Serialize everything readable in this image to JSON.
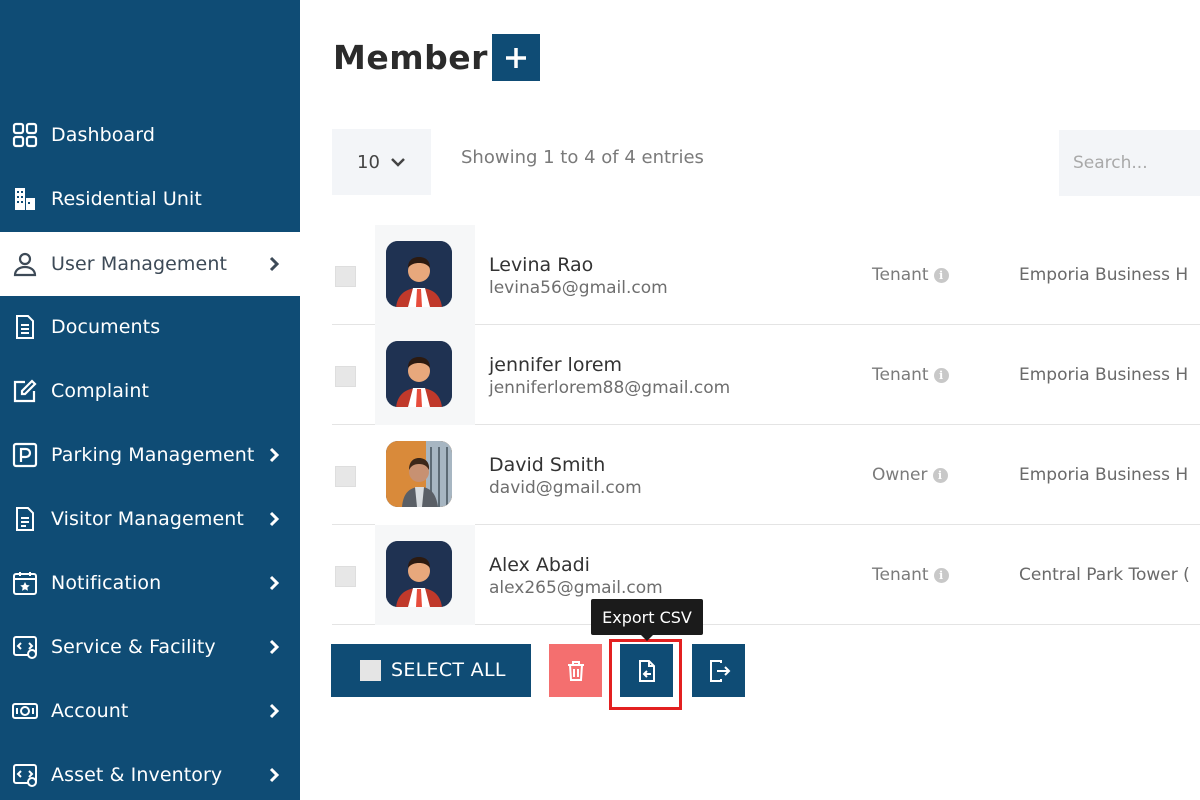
{
  "sidebar": {
    "items": [
      {
        "label": "Dashboard",
        "icon": "grid-icon",
        "chevron": false,
        "active": false
      },
      {
        "label": "Residential Unit",
        "icon": "building-icon",
        "chevron": false,
        "active": false
      },
      {
        "label": "User Management",
        "icon": "user-icon",
        "chevron": true,
        "active": true
      },
      {
        "label": "Documents",
        "icon": "document-icon",
        "chevron": false,
        "active": false
      },
      {
        "label": "Complaint",
        "icon": "edit-icon",
        "chevron": false,
        "active": false
      },
      {
        "label": "Parking Management",
        "icon": "parking-icon",
        "chevron": true,
        "active": false
      },
      {
        "label": "Visitor Management",
        "icon": "file-icon",
        "chevron": true,
        "active": false
      },
      {
        "label": "Notification",
        "icon": "calendar-star-icon",
        "chevron": true,
        "active": false
      },
      {
        "label": "Service & Facility",
        "icon": "service-icon",
        "chevron": true,
        "active": false
      },
      {
        "label": "Account",
        "icon": "money-icon",
        "chevron": true,
        "active": false
      },
      {
        "label": "Asset & Inventory",
        "icon": "asset-icon",
        "chevron": true,
        "active": false
      }
    ]
  },
  "main": {
    "title": "Member",
    "page_length": "10",
    "entries_info": "Showing 1 to 4 of 4 entries",
    "search_placeholder": "Search...",
    "rows": [
      {
        "name": "Levina Rao",
        "email": "levina56@gmail.com",
        "role": "Tenant",
        "unit": "Emporia Business H",
        "avatar": "male-avatar-icon"
      },
      {
        "name": "jennifer lorem",
        "email": "jenniferlorem88@gmail.com",
        "role": "Tenant",
        "unit": "Emporia Business H",
        "avatar": "male-avatar-icon"
      },
      {
        "name": "David Smith",
        "email": "david@gmail.com",
        "role": "Owner",
        "unit": "Emporia Business H",
        "avatar": "photo-avatar"
      },
      {
        "name": "Alex Abadi",
        "email": "alex265@gmail.com",
        "role": "Tenant",
        "unit": "Central Park Tower (",
        "avatar": "male-avatar-icon"
      }
    ],
    "actions": {
      "select_all_label": "SELECT ALL",
      "export_tooltip": "Export CSV"
    }
  },
  "colors": {
    "sidebar_bg": "#0f4c75",
    "delete_bg": "#f46f6f",
    "highlight": "#e32020"
  }
}
